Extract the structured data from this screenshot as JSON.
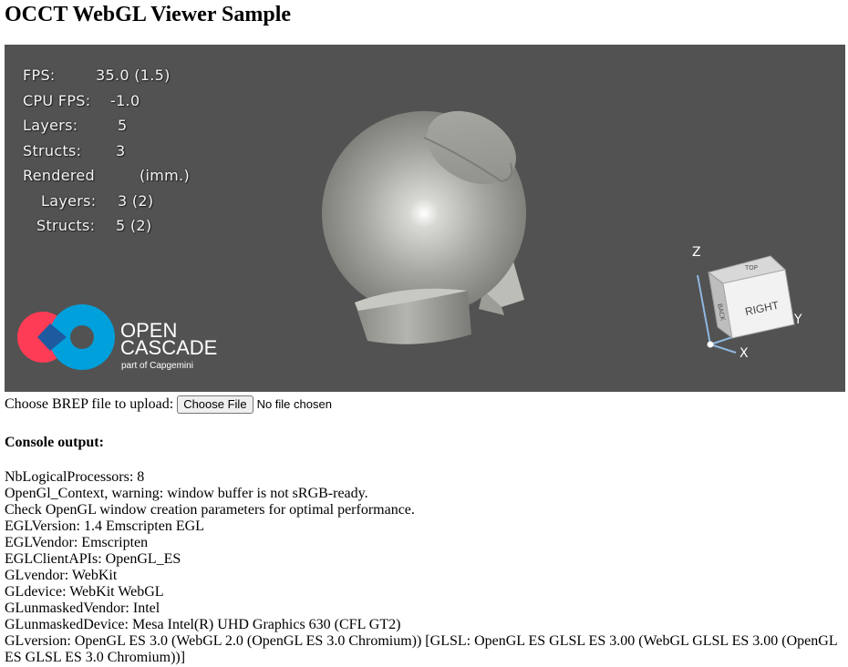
{
  "page": {
    "title": "OCCT WebGL Viewer Sample"
  },
  "viewer": {
    "background": "#525252",
    "stats": [
      {
        "label": "FPS:",
        "value": "35.0 (1.5)"
      },
      {
        "label": "CPU FPS:",
        "value": "-1.0"
      },
      {
        "label": "Layers:",
        "value": "5"
      },
      {
        "label": "Structs:",
        "value": "3"
      },
      {
        "label": "Rendered",
        "value": "(imm.)"
      },
      {
        "label": "Layers:",
        "value": "3 (2)"
      },
      {
        "label": "Structs:",
        "value": "5 (2)"
      }
    ],
    "logo": {
      "line1": "OPEN",
      "line2": "CASCADE",
      "line3": "part of Capgemini",
      "color_red": "#ff3c55",
      "color_blue": "#00a0dc",
      "color_navy": "#1e5aa0"
    },
    "view_cube": {
      "face_right": "RIGHT",
      "face_top": "TOP",
      "face_back": "BACK",
      "axis_z": "Z",
      "axis_x": "X",
      "axis_y": "Y"
    }
  },
  "upload": {
    "label": "Choose BREP file to upload:",
    "button": "Choose File",
    "status": "No file chosen"
  },
  "console": {
    "title": "Console output:",
    "lines": [
      "NbLogicalProcessors: 8",
      "OpenGl_Context, warning: window buffer is not sRGB-ready.",
      "Check OpenGL window creation parameters for optimal performance.",
      "EGLVersion: 1.4 Emscripten EGL",
      "EGLVendor: Emscripten",
      "EGLClientAPIs: OpenGL_ES",
      "GLvendor: WebKit",
      "GLdevice: WebKit WebGL",
      "GLunmaskedVendor: Intel",
      "GLunmaskedDevice: Mesa Intel(R) UHD Graphics 630 (CFL GT2)",
      "GLversion: OpenGL ES 3.0 (WebGL 2.0 (OpenGL ES 3.0 Chromium)) [GLSL: OpenGL ES GLSL ES 3.00 (WebGL GLSL ES 3.00 (OpenGL ES GLSL ES 3.0 Chromium))]"
    ]
  }
}
